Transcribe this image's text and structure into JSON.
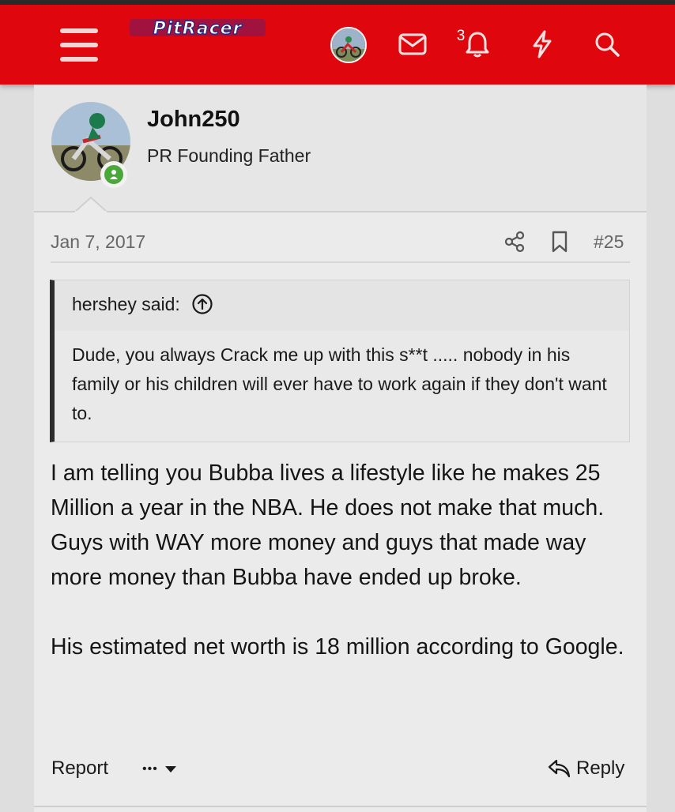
{
  "header": {
    "logo_text": "PitRacer",
    "notification_count": "3",
    "colors": {
      "header_bg": "#e0060e",
      "online": "#4aa83a"
    },
    "icons": [
      "menu-icon",
      "avatar",
      "envelope-icon",
      "bell-icon",
      "lightning-icon",
      "search-icon"
    ]
  },
  "post": {
    "username": "John250",
    "user_title": "PR Founding Father",
    "date": "Jan 7, 2017",
    "post_number": "#25",
    "quote": {
      "attribution": "hershey said:",
      "text": "Dude, you always Crack me up with this s**t ..... nobody in his family or his children will ever have to work again if they don't want to."
    },
    "paragraphs": [
      "I am telling you Bubba lives a lifestyle like he makes 25 Million a year in the NBA. He does not make that much. Guys with WAY more money and guys that made way more money than Bubba have ended up broke.",
      "His estimated net worth is 18 million according to Google."
    ],
    "actions": {
      "report": "Report",
      "more": "•••",
      "reply": "Reply"
    }
  }
}
